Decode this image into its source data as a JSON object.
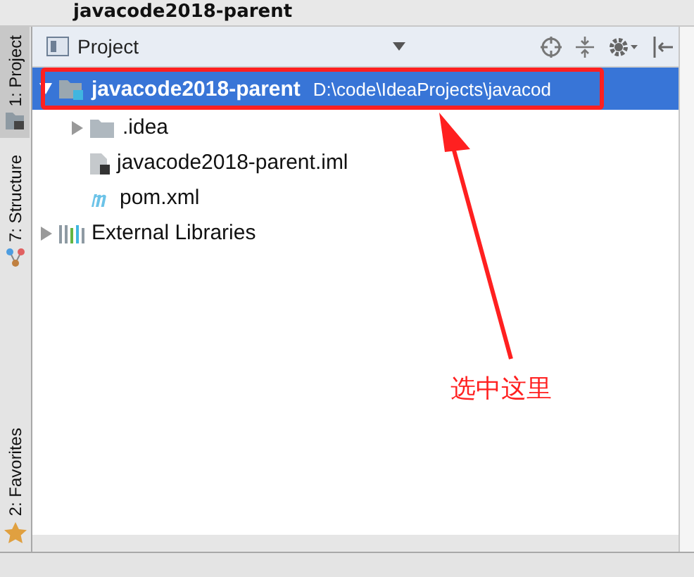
{
  "window": {
    "title": "javacode2018-parent"
  },
  "side_tabs": [
    {
      "label": "1: Project",
      "selected": true
    },
    {
      "label": "7: Structure",
      "selected": false
    },
    {
      "label": "2: Favorites",
      "selected": false
    }
  ],
  "panel": {
    "title": "Project"
  },
  "tree": [
    {
      "label": "javacode2018-parent",
      "path": "D:\\code\\IdeaProjects\\javacod",
      "kind": "module",
      "selected": true,
      "expanded": true,
      "children": [
        {
          "label": ".idea",
          "kind": "folder",
          "selected": false,
          "expanded": false
        },
        {
          "label": "javacode2018-parent.iml",
          "kind": "iml",
          "selected": false
        },
        {
          "label": "pom.xml",
          "kind": "maven",
          "selected": false
        }
      ]
    },
    {
      "label": "External Libraries",
      "kind": "libraries",
      "selected": false,
      "expanded": false
    }
  ],
  "annotation": {
    "text": "选中这里"
  }
}
